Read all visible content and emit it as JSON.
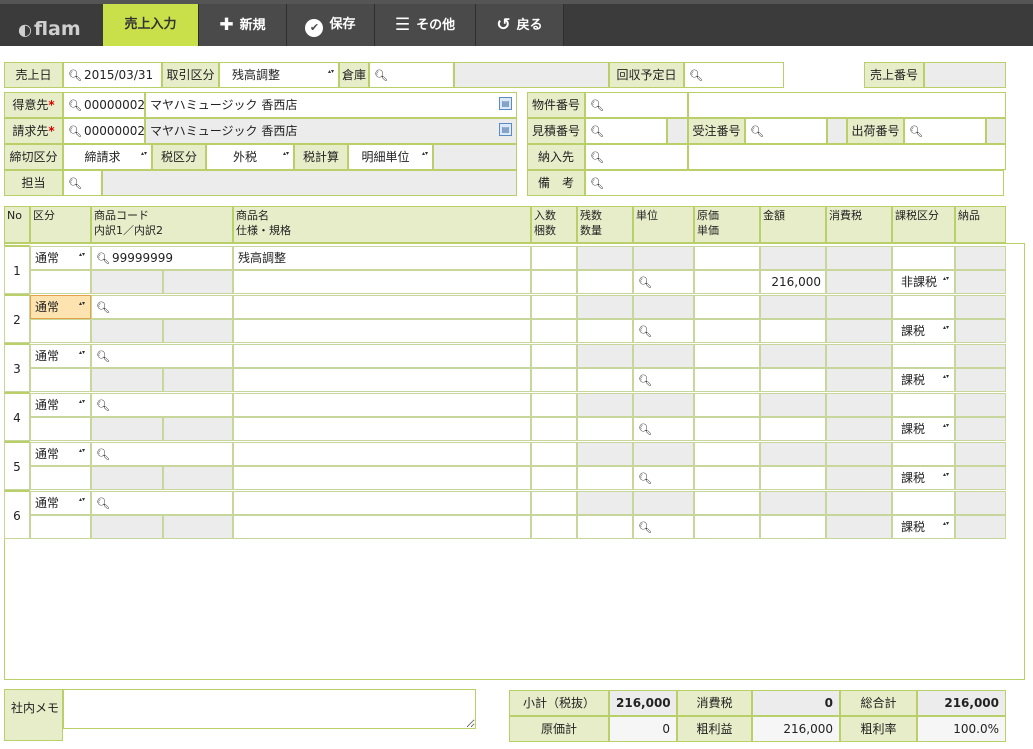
{
  "toolbar": {
    "logo": "flam",
    "buttons": [
      {
        "label": "売上入力"
      },
      {
        "label": "新規"
      },
      {
        "label": "保存"
      },
      {
        "label": "その他"
      },
      {
        "label": "戻る"
      }
    ]
  },
  "header": {
    "sales_date_label": "売上日",
    "sales_date": "2015/03/31",
    "txn_type_label": "取引区分",
    "txn_type": "残高調整",
    "warehouse_label": "倉庫",
    "collect_date_label": "回収予定日",
    "sales_no_label": "売上番号",
    "customer_label": "得意先",
    "customer_code": "00000002",
    "customer_name": "マヤハミュージック 香西店",
    "billto_label": "請求先",
    "billto_code": "00000002",
    "billto_name": "マヤハミュージック 香西店",
    "closing_label": "締切区分",
    "closing": "締請求",
    "tax_label": "税区分",
    "tax": "外税",
    "taxcalc_label": "税計算",
    "taxcalc": "明細単位",
    "staff_label": "担当",
    "property_label": "物件番号",
    "estimate_label": "見積番号",
    "order_label": "受注番号",
    "shipping_label": "出荷番号",
    "delivery_label": "納入先",
    "remarks_label": "備　考",
    "required_mark": "*"
  },
  "columns": {
    "no": "No",
    "kubun": "区分",
    "code1": "商品コード",
    "code2": "内訳1／内訳2",
    "name1": "商品名",
    "name2": "仕様・規格",
    "qty1": "入数",
    "qty2": "梱数",
    "rem1": "残数",
    "rem2": "数量",
    "unit": "単位",
    "cost1": "原価",
    "cost2": "単価",
    "amount": "金額",
    "tax": "消費税",
    "taxtype": "課税区分",
    "delivery": "納品"
  },
  "rows": [
    {
      "no": "1",
      "kubun": "通常",
      "code": "99999999",
      "name": "残高調整",
      "amount": "216,000",
      "taxtype": "非課税"
    },
    {
      "no": "2",
      "kubun": "通常",
      "code": "",
      "name": "",
      "amount": "",
      "taxtype": "課税"
    },
    {
      "no": "3",
      "kubun": "通常",
      "code": "",
      "name": "",
      "amount": "",
      "taxtype": "課税"
    },
    {
      "no": "4",
      "kubun": "通常",
      "code": "",
      "name": "",
      "amount": "",
      "taxtype": "課税"
    },
    {
      "no": "5",
      "kubun": "通常",
      "code": "",
      "name": "",
      "amount": "",
      "taxtype": "課税"
    },
    {
      "no": "6",
      "kubun": "通常",
      "code": "",
      "name": "",
      "amount": "",
      "taxtype": "課税"
    }
  ],
  "footer": {
    "memo_label": "社内メモ",
    "subtotal_label": "小計（税抜）",
    "subtotal": "216,000",
    "tax_label": "消費税",
    "tax": "0",
    "total_label": "総合計",
    "total": "216,000",
    "cost_label": "原価計",
    "cost": "0",
    "profit_label": "粗利益",
    "profit": "216,000",
    "rate_label": "粗利率",
    "rate": "100.0%"
  }
}
